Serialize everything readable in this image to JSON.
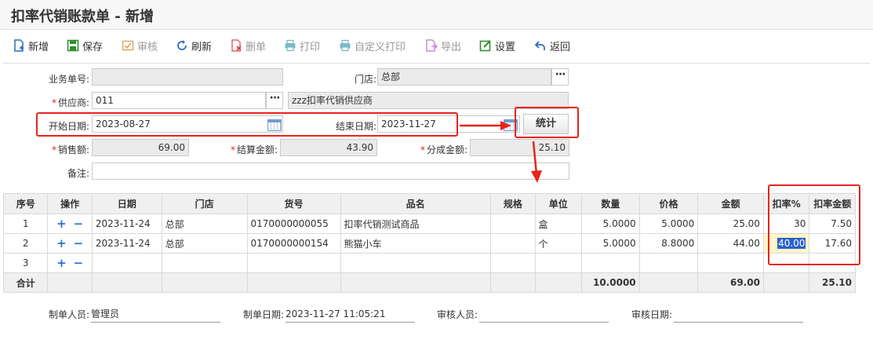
{
  "window": {
    "title": "扣率代销账款单 - 新增"
  },
  "toolbar": {
    "items": [
      {
        "label": "新增",
        "icon": "new-doc-icon",
        "enabled": true
      },
      {
        "label": "保存",
        "icon": "save-icon",
        "enabled": true
      },
      {
        "label": "审核",
        "icon": "audit-icon",
        "enabled": false
      },
      {
        "label": "刷新",
        "icon": "refresh-icon",
        "enabled": true
      },
      {
        "label": "删单",
        "icon": "delete-doc-icon",
        "enabled": false
      },
      {
        "label": "打印",
        "icon": "print-icon",
        "enabled": false
      },
      {
        "label": "自定义打印",
        "icon": "custom-print-icon",
        "enabled": false
      },
      {
        "label": "导出",
        "icon": "export-icon",
        "enabled": false
      },
      {
        "label": "设置",
        "icon": "settings-icon",
        "enabled": true
      },
      {
        "label": "返回",
        "icon": "back-icon",
        "enabled": true
      }
    ]
  },
  "form": {
    "doc_no": {
      "label": "业务单号:",
      "value": ""
    },
    "store": {
      "label": "门店:",
      "value": "总部"
    },
    "supplier": {
      "label": "供应商:",
      "code": "011",
      "name": "zzz扣率代销供应商"
    },
    "start_date": {
      "label": "开始日期:",
      "value": "2023-08-27"
    },
    "end_date": {
      "label": "结束日期:",
      "value": "2023-11-27"
    },
    "stat_button": "统计",
    "sales_amount": {
      "label": "销售额:",
      "value": "69.00"
    },
    "settle_amount": {
      "label": "结算金额:",
      "value": "43.90"
    },
    "share_amount": {
      "label": "分成金额:",
      "value": "25.10"
    },
    "remark": {
      "label": "备注:",
      "value": ""
    },
    "required_mark": "*"
  },
  "grid": {
    "headers": [
      "序号",
      "操作",
      "日期",
      "门店",
      "货号",
      "品名",
      "规格",
      "单位",
      "数量",
      "价格",
      "金额",
      "扣率%",
      "扣率金额"
    ],
    "rows": [
      {
        "no": "1",
        "date": "2023-11-24",
        "store": "总部",
        "code": "0170000000055",
        "name": "扣率代销测试商品",
        "spec": "",
        "unit": "盒",
        "qty": "5.0000",
        "price": "5.0000",
        "amount": "25.00",
        "rate": "30",
        "rate_amount": "7.50"
      },
      {
        "no": "2",
        "date": "2023-11-24",
        "store": "总部",
        "code": "0170000000154",
        "name": "熊猫小车",
        "spec": "",
        "unit": "个",
        "qty": "5.0000",
        "price": "8.8000",
        "amount": "44.00",
        "rate": "40.00",
        "rate_amount": "17.60"
      },
      {
        "no": "3",
        "date": "",
        "store": "",
        "code": "",
        "name": "",
        "spec": "",
        "unit": "",
        "qty": "",
        "price": "",
        "amount": "",
        "rate": "",
        "rate_amount": ""
      }
    ],
    "op_add": "+",
    "op_remove": "−",
    "total": {
      "label": "合计",
      "qty": "10.0000",
      "amount": "69.00",
      "rate_amount": "25.10"
    }
  },
  "footer": {
    "creator": {
      "label": "制单人员:",
      "value": "管理员"
    },
    "create_date": {
      "label": "制单日期:",
      "value": "2023-11-27 11:05:21"
    },
    "auditor": {
      "label": "审核人员:",
      "value": ""
    },
    "audit_date": {
      "label": "审核日期:",
      "value": ""
    }
  },
  "colors": {
    "annotation_red": "#e8231c",
    "plus_minus_blue": "#2a6fd6",
    "selection_blue": "#2962cc"
  }
}
